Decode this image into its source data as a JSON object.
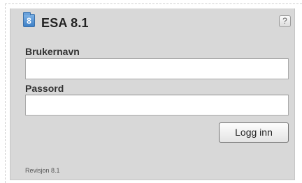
{
  "header": {
    "icon_label": "8",
    "app_icon": "folder-icon",
    "title": "ESA 8.1",
    "help_label": "?",
    "help_icon": "help-icon"
  },
  "form": {
    "username_label": "Brukernavn",
    "username_value": "",
    "password_label": "Passord",
    "password_value": "",
    "login_label": "Logg inn"
  },
  "footer": {
    "revision": "Revisjon 8.1"
  },
  "colors": {
    "panel_background": "#d8d8d8",
    "accent_icon": "#3d7fc6"
  }
}
